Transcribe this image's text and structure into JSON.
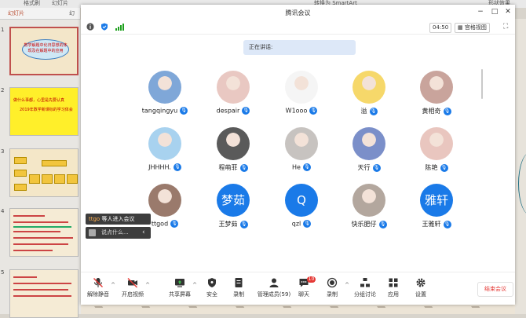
{
  "ppt": {
    "top_text_left": "格式刷",
    "top_text_mid": "幻灯片",
    "top_text_right": "转换为 SmartArt",
    "top_text_far": "形状效果",
    "tab_outline": "幻灯片",
    "tab_slides": "幻",
    "sidebar_title": "幻灯片",
    "slide_numbers": [
      "1",
      "2",
      "3",
      "4",
      "5"
    ],
    "slide1_text": "数学解题中化归思想的体现及在解题中的应用",
    "slide2_line1": "做什么事都，心里是先要认真",
    "slide2_line2": "2019年数学新课标的学习体会"
  },
  "meeting": {
    "title": "腾讯会议",
    "timer": "04:50",
    "view_label": "宫格视图",
    "speaking_label": "正在讲话:",
    "participants": [
      {
        "name": "tangqingyu",
        "type": "photo",
        "color": "#7fa7d8"
      },
      {
        "name": "despair",
        "type": "photo",
        "color": "#e9c8c2"
      },
      {
        "name": "W1ooo",
        "type": "photo",
        "color": "#f5f5f5"
      },
      {
        "name": "溢",
        "type": "photo",
        "color": "#f6d86a"
      },
      {
        "name": "黄相奇",
        "type": "photo",
        "color": "#c9a49c"
      },
      {
        "name": "JHHHH.",
        "type": "photo",
        "color": "#a8d2ef"
      },
      {
        "name": "程萌菲",
        "type": "photo",
        "color": "#5a5a5a"
      },
      {
        "name": "He",
        "type": "photo",
        "color": "#c7c3c0"
      },
      {
        "name": "天行",
        "type": "photo",
        "color": "#7b8fc9"
      },
      {
        "name": "陈艳",
        "type": "photo",
        "color": "#e9c6bf"
      },
      {
        "name": "ttgod",
        "type": "photo",
        "color": "#9a7a6c"
      },
      {
        "name": "王梦茹",
        "type": "text",
        "initials": "梦茹",
        "color": "#1a7ae8"
      },
      {
        "name": "qzl",
        "type": "text",
        "initials": "Q",
        "color": "#1a7ae8"
      },
      {
        "name": "快乐肥仔",
        "type": "photo",
        "color": "#b3a79e"
      },
      {
        "name": "王雅轩",
        "type": "text",
        "initials": "雅轩",
        "color": "#1a7ae8"
      }
    ],
    "tooltip_highlight": "ttgo",
    "tooltip_rest": " 等人进入会议",
    "tooltip_chat": "说点什么...",
    "toolbar": {
      "mic": "解除静音",
      "video": "开启视频",
      "share": "共享屏幕",
      "security": "安全",
      "record": "录制",
      "members": "管理成员(59)",
      "chat": "聊天",
      "chat_badge": "10",
      "record2": "录制",
      "breakout": "分组讨论",
      "apps": "应用",
      "settings": "设置",
      "end": "结束会议"
    }
  }
}
